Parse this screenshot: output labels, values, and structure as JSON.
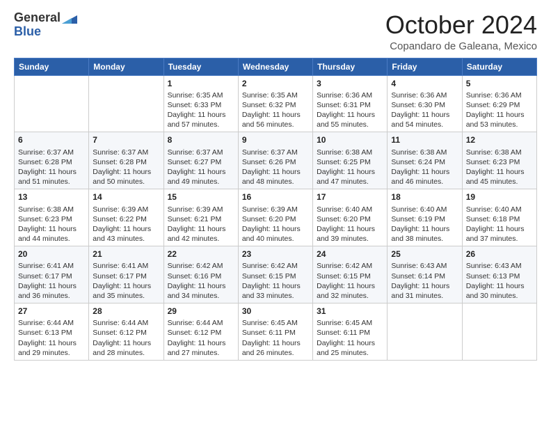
{
  "header": {
    "logo_general": "General",
    "logo_blue": "Blue",
    "month_title": "October 2024",
    "subtitle": "Copandaro de Galeana, Mexico"
  },
  "weekdays": [
    "Sunday",
    "Monday",
    "Tuesday",
    "Wednesday",
    "Thursday",
    "Friday",
    "Saturday"
  ],
  "weeks": [
    [
      null,
      null,
      {
        "day": 1,
        "sunrise": "6:35 AM",
        "sunset": "6:33 PM",
        "daylight": "11 hours and 57 minutes."
      },
      {
        "day": 2,
        "sunrise": "6:35 AM",
        "sunset": "6:32 PM",
        "daylight": "11 hours and 56 minutes."
      },
      {
        "day": 3,
        "sunrise": "6:36 AM",
        "sunset": "6:31 PM",
        "daylight": "11 hours and 55 minutes."
      },
      {
        "day": 4,
        "sunrise": "6:36 AM",
        "sunset": "6:30 PM",
        "daylight": "11 hours and 54 minutes."
      },
      {
        "day": 5,
        "sunrise": "6:36 AM",
        "sunset": "6:29 PM",
        "daylight": "11 hours and 53 minutes."
      }
    ],
    [
      {
        "day": 6,
        "sunrise": "6:37 AM",
        "sunset": "6:28 PM",
        "daylight": "11 hours and 51 minutes."
      },
      {
        "day": 7,
        "sunrise": "6:37 AM",
        "sunset": "6:28 PM",
        "daylight": "11 hours and 50 minutes."
      },
      {
        "day": 8,
        "sunrise": "6:37 AM",
        "sunset": "6:27 PM",
        "daylight": "11 hours and 49 minutes."
      },
      {
        "day": 9,
        "sunrise": "6:37 AM",
        "sunset": "6:26 PM",
        "daylight": "11 hours and 48 minutes."
      },
      {
        "day": 10,
        "sunrise": "6:38 AM",
        "sunset": "6:25 PM",
        "daylight": "11 hours and 47 minutes."
      },
      {
        "day": 11,
        "sunrise": "6:38 AM",
        "sunset": "6:24 PM",
        "daylight": "11 hours and 46 minutes."
      },
      {
        "day": 12,
        "sunrise": "6:38 AM",
        "sunset": "6:23 PM",
        "daylight": "11 hours and 45 minutes."
      }
    ],
    [
      {
        "day": 13,
        "sunrise": "6:38 AM",
        "sunset": "6:23 PM",
        "daylight": "11 hours and 44 minutes."
      },
      {
        "day": 14,
        "sunrise": "6:39 AM",
        "sunset": "6:22 PM",
        "daylight": "11 hours and 43 minutes."
      },
      {
        "day": 15,
        "sunrise": "6:39 AM",
        "sunset": "6:21 PM",
        "daylight": "11 hours and 42 minutes."
      },
      {
        "day": 16,
        "sunrise": "6:39 AM",
        "sunset": "6:20 PM",
        "daylight": "11 hours and 40 minutes."
      },
      {
        "day": 17,
        "sunrise": "6:40 AM",
        "sunset": "6:20 PM",
        "daylight": "11 hours and 39 minutes."
      },
      {
        "day": 18,
        "sunrise": "6:40 AM",
        "sunset": "6:19 PM",
        "daylight": "11 hours and 38 minutes."
      },
      {
        "day": 19,
        "sunrise": "6:40 AM",
        "sunset": "6:18 PM",
        "daylight": "11 hours and 37 minutes."
      }
    ],
    [
      {
        "day": 20,
        "sunrise": "6:41 AM",
        "sunset": "6:17 PM",
        "daylight": "11 hours and 36 minutes."
      },
      {
        "day": 21,
        "sunrise": "6:41 AM",
        "sunset": "6:17 PM",
        "daylight": "11 hours and 35 minutes."
      },
      {
        "day": 22,
        "sunrise": "6:42 AM",
        "sunset": "6:16 PM",
        "daylight": "11 hours and 34 minutes."
      },
      {
        "day": 23,
        "sunrise": "6:42 AM",
        "sunset": "6:15 PM",
        "daylight": "11 hours and 33 minutes."
      },
      {
        "day": 24,
        "sunrise": "6:42 AM",
        "sunset": "6:15 PM",
        "daylight": "11 hours and 32 minutes."
      },
      {
        "day": 25,
        "sunrise": "6:43 AM",
        "sunset": "6:14 PM",
        "daylight": "11 hours and 31 minutes."
      },
      {
        "day": 26,
        "sunrise": "6:43 AM",
        "sunset": "6:13 PM",
        "daylight": "11 hours and 30 minutes."
      }
    ],
    [
      {
        "day": 27,
        "sunrise": "6:44 AM",
        "sunset": "6:13 PM",
        "daylight": "11 hours and 29 minutes."
      },
      {
        "day": 28,
        "sunrise": "6:44 AM",
        "sunset": "6:12 PM",
        "daylight": "11 hours and 28 minutes."
      },
      {
        "day": 29,
        "sunrise": "6:44 AM",
        "sunset": "6:12 PM",
        "daylight": "11 hours and 27 minutes."
      },
      {
        "day": 30,
        "sunrise": "6:45 AM",
        "sunset": "6:11 PM",
        "daylight": "11 hours and 26 minutes."
      },
      {
        "day": 31,
        "sunrise": "6:45 AM",
        "sunset": "6:11 PM",
        "daylight": "11 hours and 25 minutes."
      },
      null,
      null
    ]
  ],
  "labels": {
    "sunrise": "Sunrise:",
    "sunset": "Sunset:",
    "daylight": "Daylight:"
  }
}
